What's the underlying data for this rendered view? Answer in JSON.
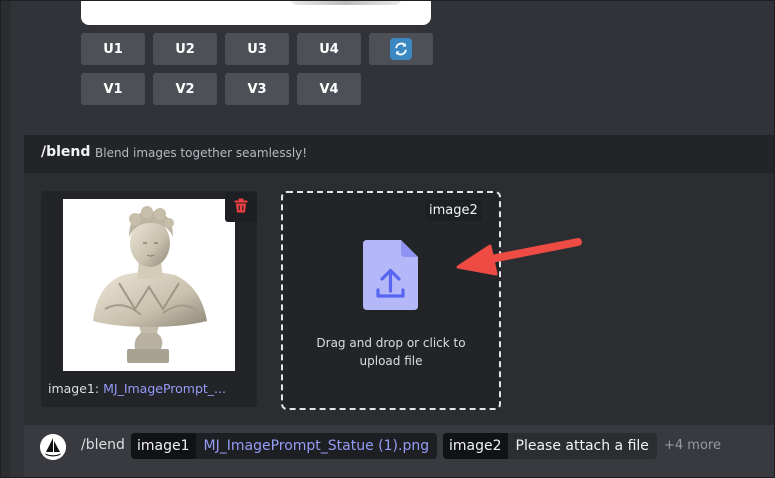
{
  "upscale_buttons": [
    "U1",
    "U2",
    "U3",
    "U4"
  ],
  "variation_buttons": [
    "V1",
    "V2",
    "V3",
    "V4"
  ],
  "reroll_icon": "refresh-icon",
  "command": {
    "name": "/blend",
    "description": "Blend images together seamlessly!"
  },
  "image1": {
    "label": "image1:",
    "filename": "MJ_ImagePrompt_..."
  },
  "image2": {
    "tag": "image2",
    "drop_text_line1": "Drag and drop or click to",
    "drop_text_line2": "upload file"
  },
  "input_bar": {
    "command": "/blend",
    "option1_key": "image1",
    "option1_value": "MJ_ImagePrompt_Statue (1).png",
    "option2_key": "image2",
    "option2_value": "Please attach a file",
    "more": "+4 more"
  },
  "colors": {
    "background": "#313338",
    "panel": "#2b2d31",
    "button": "#4e5058",
    "link": "#949cf7",
    "upload_icon": "#b4b8f8",
    "delete": "#f23f43",
    "arrow": "#ee4b45"
  }
}
